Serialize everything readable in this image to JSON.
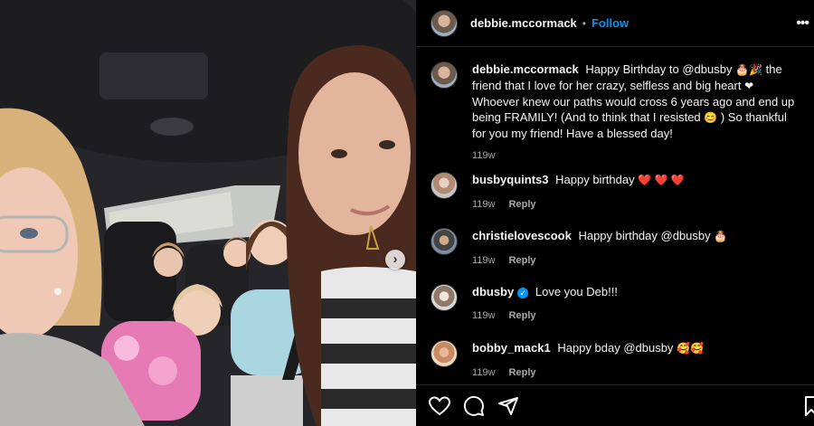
{
  "post": {
    "author": "debbie.mccormack",
    "separator": "•",
    "follow_label": "Follow",
    "more_label": "•••",
    "carousel_next": "›"
  },
  "caption": {
    "username": "debbie.mccormack",
    "text_1": "Happy Birthday to @dbusby",
    "emoji_1": "🎂🎉",
    "text_2": "the friend that I love for her crazy, selfless and big heart",
    "emoji_2": "❤",
    "text_3": "Whoever knew our paths would cross 6 years ago and end up being FRAMILY! (And to think that I resisted",
    "emoji_3": "😊",
    "text_4": ") So thankful for you my friend! Have a blessed day!",
    "time": "119w"
  },
  "comments": [
    {
      "username": "busbyquints3",
      "verified": false,
      "text": "Happy birthday",
      "emoji": "❤️ ❤️ ❤️",
      "emoji_color": "#ff2d43",
      "time": "119w",
      "reply": "Reply"
    },
    {
      "username": "christielovescook",
      "verified": false,
      "text": "Happy birthday @dbusby",
      "emoji": "🎂",
      "emoji_color": "",
      "time": "119w",
      "reply": "Reply"
    },
    {
      "username": "dbusby",
      "verified": true,
      "verified_mark": "✓",
      "text": "Love you Deb!!!",
      "emoji": "",
      "emoji_color": "",
      "time": "119w",
      "reply": "Reply"
    },
    {
      "username": "bobby_mack1",
      "verified": false,
      "text": "Happy bday @dbusby",
      "emoji": "🥰🥰",
      "emoji_color": "",
      "time": "119w",
      "reply": "Reply"
    }
  ],
  "actions": {
    "like": "heart-icon",
    "comment": "comment-icon",
    "share": "share-icon",
    "save": "bookmark-icon"
  },
  "colors": {
    "accent": "#0095f6",
    "muted": "#a8a8a8",
    "heart": "#ff2d43",
    "background": "#000000"
  }
}
